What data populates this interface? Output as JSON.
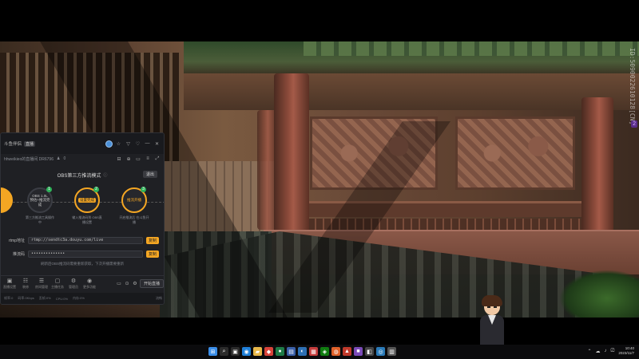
{
  "game": {
    "watermark": "ID:5090022610128[CN]",
    "side_badge": "2"
  },
  "panel": {
    "header": {
      "app_name": "斗鱼伴侣",
      "tag": "直播",
      "avatar_icon": "user-avatar-icon",
      "window_buttons": [
        "☆",
        "▽",
        "♡",
        "—",
        "✕"
      ]
    },
    "sub": {
      "room_info": "hhweikieo的直播间  DR6796",
      "viewer_count": "0",
      "icons": [
        "⊟",
        "⊕",
        "▭",
        "≡",
        "⤢"
      ]
    },
    "mode_title": "OBS第三方推流模式",
    "exit_label": "退出",
    "steps": [
      {
        "num": "",
        "title": "",
        "label": "",
        "state": "done"
      },
      {
        "num": "1",
        "title": "OBS 1.0L",
        "title2": "预估+推流完成",
        "label": "第三方推流工具操作中",
        "state": "normal"
      },
      {
        "num": "2",
        "title": "设置完成",
        "label": "输入推流码到 OBS直播设置",
        "state": "active"
      },
      {
        "num": "3",
        "title": "推流开播",
        "label": "开启推流后 在斗鱼开播",
        "state": "normal"
      }
    ],
    "form": {
      "rtmp_label": "rtmp地址",
      "rtmp_value": "rtmp://sendtc3a.douyu.com/live",
      "rtmp_btn": "复制",
      "code_label": "推流码",
      "code_value": "••••••••••••••",
      "code_btn": "复制"
    },
    "hint": "刷新后OBS推流码需要重新获取，下次开播需要重新",
    "toolbar": [
      {
        "icon": "▣",
        "label": "直播设置",
        "name": "live-settings"
      },
      {
        "icon": "☷",
        "label": "装修",
        "name": "decorate"
      },
      {
        "icon": "☰",
        "label": "房间管理",
        "name": "room-manage"
      },
      {
        "icon": "▢",
        "label": "主播任务",
        "name": "tasks"
      },
      {
        "icon": "⚙",
        "label": "管理员",
        "name": "admin"
      },
      {
        "icon": "◉",
        "label": "更多功能",
        "name": "more"
      }
    ],
    "toolbar_right_icons": [
      "▭",
      "⊙",
      "⚙"
    ],
    "start_label": "开始直播",
    "status": [
      "帧率:0",
      "码率:0Kbps",
      "丢帧:0%",
      "CPU:0%",
      "内存:0%",
      "流畅"
    ]
  },
  "taskbar": {
    "apps": [
      {
        "glyph": "⊞",
        "color": "#3b8ee8",
        "name": "start-icon"
      },
      {
        "glyph": "⌕",
        "color": "#2b2b2b",
        "name": "search-icon"
      },
      {
        "glyph": "▣",
        "color": "#2b2b2b",
        "name": "task-view-icon"
      },
      {
        "glyph": "◉",
        "color": "#1f7fd8",
        "name": "edge-icon"
      },
      {
        "glyph": "▰",
        "color": "#e8b84a",
        "name": "explorer-icon"
      },
      {
        "glyph": "◆",
        "color": "#d8433a",
        "name": "app-red-icon"
      },
      {
        "glyph": "●",
        "color": "#1e7a46",
        "name": "chrome-icon"
      },
      {
        "glyph": "▤",
        "color": "#3a5fa8",
        "name": "store-icon"
      },
      {
        "glyph": "◐",
        "color": "#2d6fb3",
        "name": "steam-icon"
      },
      {
        "glyph": "▦",
        "color": "#c43c3c",
        "name": "app-game-icon"
      },
      {
        "glyph": "◈",
        "color": "#107c10",
        "name": "xbox-icon"
      },
      {
        "glyph": "◍",
        "color": "#e0612a",
        "name": "douyu-icon"
      },
      {
        "glyph": "▲",
        "color": "#c0392b",
        "name": "app-tri-icon"
      },
      {
        "glyph": "■",
        "color": "#7a4ab8",
        "name": "obs-icon"
      },
      {
        "glyph": "◧",
        "color": "#444",
        "name": "app-misc-icon"
      },
      {
        "glyph": "◎",
        "color": "#2a7ab8",
        "name": "app-circle-icon"
      },
      {
        "glyph": "▥",
        "color": "#555",
        "name": "app-grid-icon"
      }
    ],
    "tray_icons": [
      "⌃",
      "☁",
      "♪",
      "⎚"
    ],
    "time": "10:40",
    "date": "2023/11/7"
  }
}
